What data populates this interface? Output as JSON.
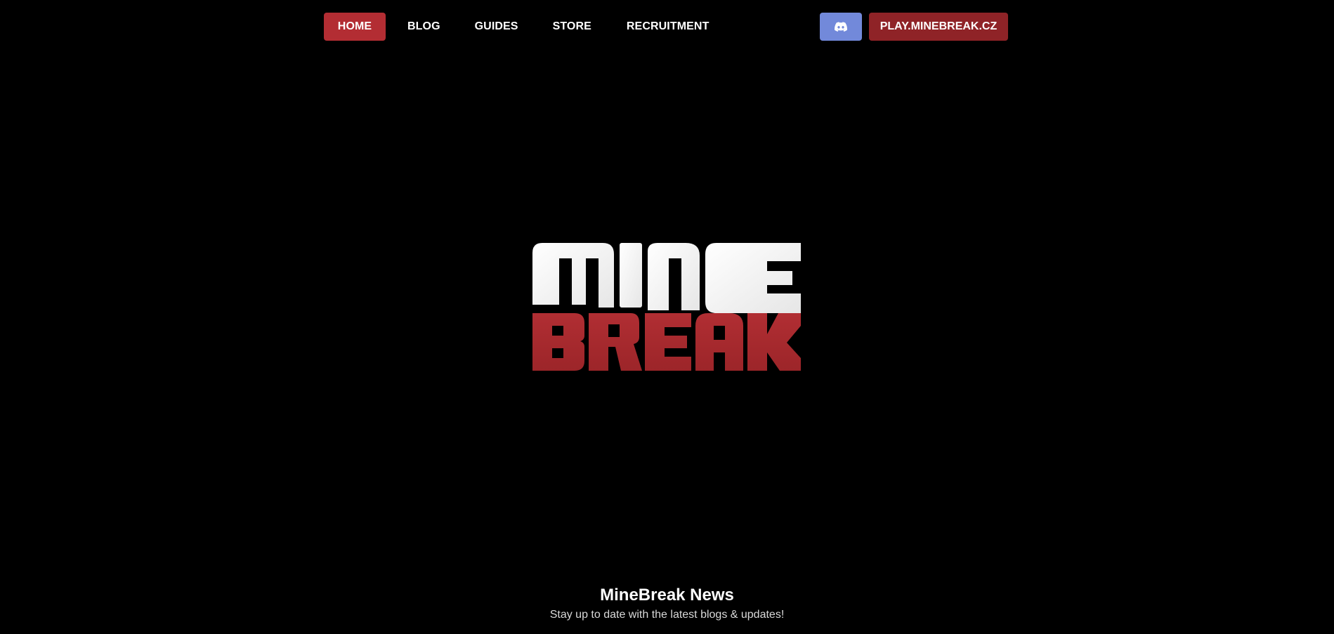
{
  "nav": {
    "items": [
      {
        "label": "HOME",
        "active": true
      },
      {
        "label": "BLOG",
        "active": false
      },
      {
        "label": "GUIDES",
        "active": false
      },
      {
        "label": "STORE",
        "active": false
      },
      {
        "label": "RECRUITMENT",
        "active": false
      }
    ],
    "discord_icon": "discord-icon",
    "play_label": "PLAY.MINEBREAK.CZ"
  },
  "logo": {
    "line1": "MINE",
    "line2": "BREAK",
    "line1_color": "#f2f2f2",
    "line2_color": "#a8282d"
  },
  "news": {
    "title": "MineBreak News",
    "subtitle": "Stay up to date with the latest blogs & updates!"
  },
  "colors": {
    "background": "#000000",
    "accent": "#b32d33",
    "play_button": "#8f2327",
    "discord": "#7289da"
  }
}
